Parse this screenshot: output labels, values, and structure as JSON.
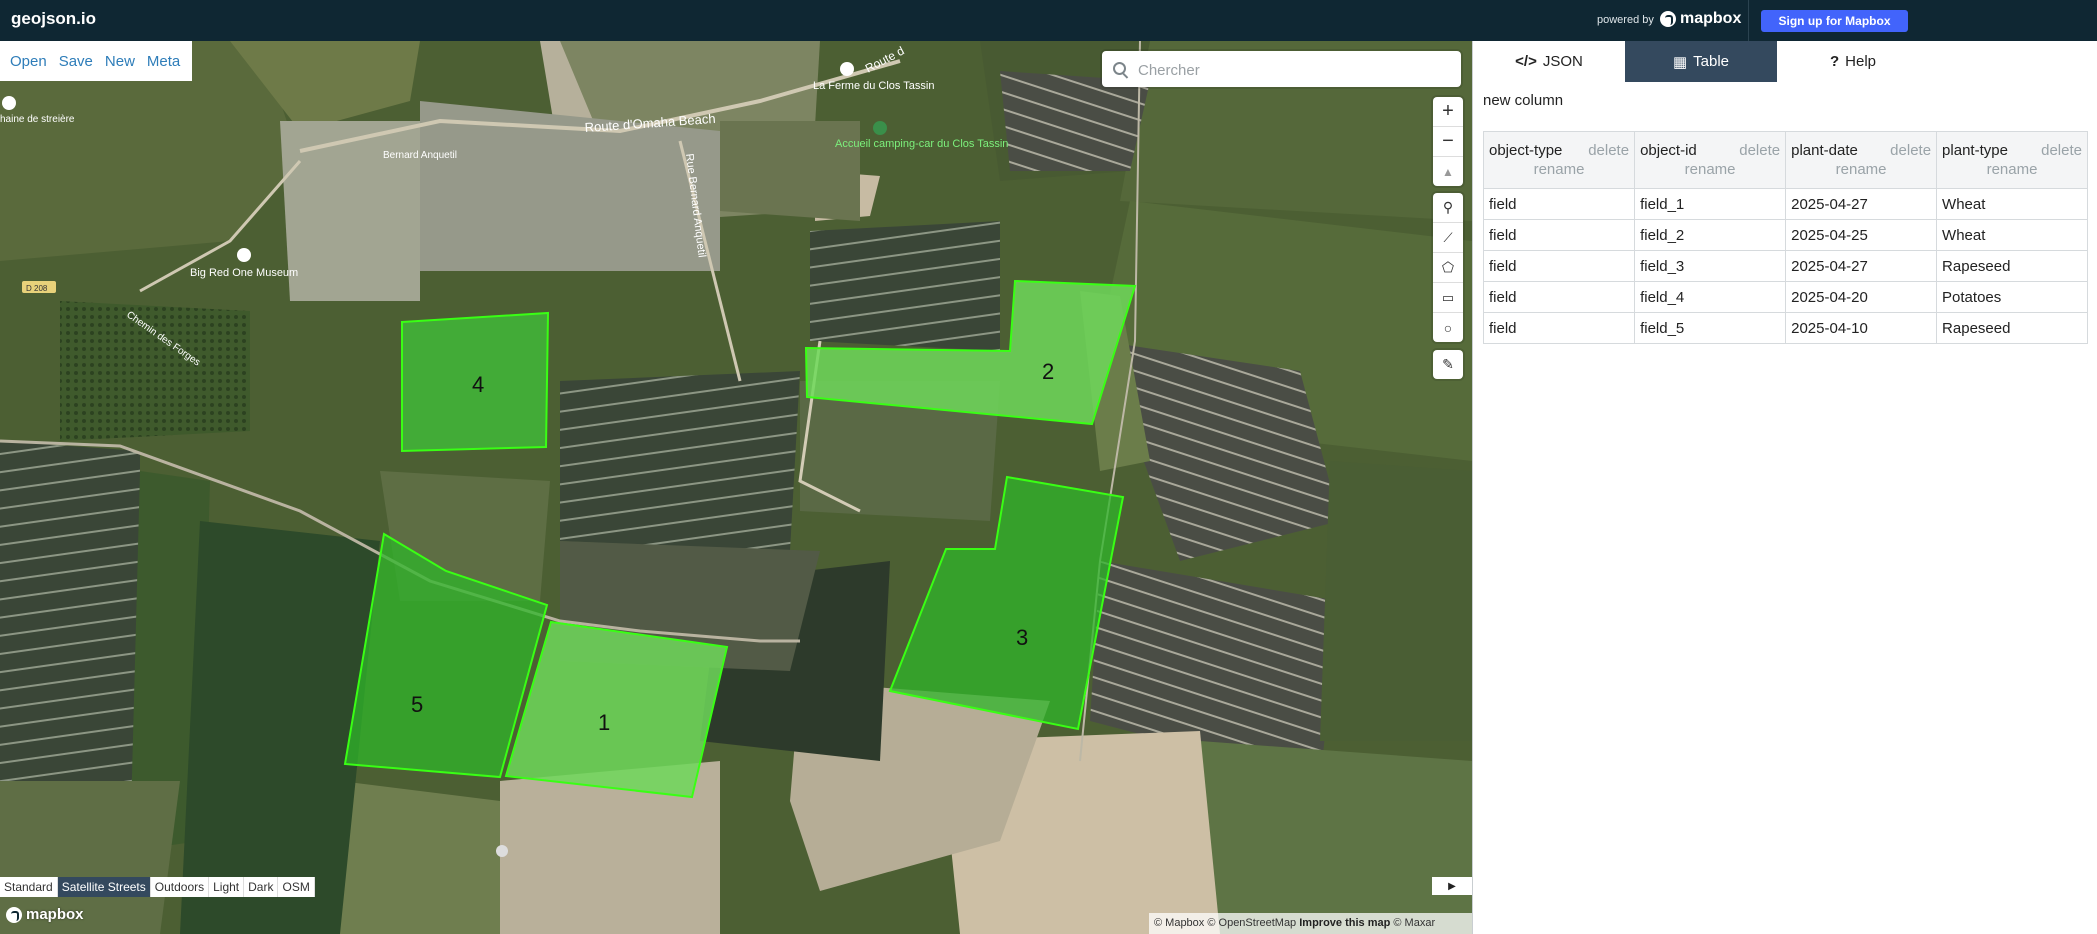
{
  "topbar": {
    "brand": "geojson.io",
    "powered_by": "powered by",
    "mapbox_logo": "mapbox",
    "signup_label": "Sign up for Mapbox"
  },
  "file_menu": [
    "Open",
    "Save",
    "New",
    "Meta"
  ],
  "search": {
    "placeholder": "Chercher"
  },
  "map_labels": {
    "route_omaha": "Route d'Omaha Beach",
    "rue_bernard": "Rue Bernard Anquetil",
    "bernard": "Bernard Anquetil",
    "ferme": "La Ferme du Clos Tassin",
    "camping": "Accueil camping-car du Clos Tassin",
    "museum": "Big Red One Museum",
    "d208": "D 208",
    "chemin_forges": "Chemin des Forges",
    "chaine": "haine de streière",
    "route_top": "Route d"
  },
  "fields": [
    {
      "id": "field_1",
      "label": "1",
      "color": "#6fd85a"
    },
    {
      "id": "field_2",
      "label": "2",
      "color": "#6fd85a"
    },
    {
      "id": "field_3",
      "label": "3",
      "color": "#2fb52a"
    },
    {
      "id": "field_4",
      "label": "4",
      "color": "#3fc43a"
    },
    {
      "id": "field_5",
      "label": "5",
      "color": "#2fb52a"
    }
  ],
  "map_styles": [
    "Standard",
    "Satellite Streets",
    "Outdoors",
    "Light",
    "Dark",
    "OSM"
  ],
  "active_style": "Satellite Streets",
  "mapbox_watermark": "mapbox",
  "attribution": {
    "mapbox": "© Mapbox",
    "osm": "© OpenStreetMap",
    "improve": "Improve this map",
    "maxar": "© Maxar"
  },
  "sidebar": {
    "tabs": [
      {
        "label": "JSON",
        "icon": "code-icon"
      },
      {
        "label": "Table",
        "icon": "table-icon"
      },
      {
        "label": "Help",
        "icon": "help-icon"
      }
    ],
    "active_tab": "Table",
    "new_column": "new column",
    "columns": [
      "object-type",
      "object-id",
      "plant-date",
      "plant-type"
    ],
    "delete_label": "delete",
    "rename_label": "rename",
    "rows": [
      [
        "field",
        "field_1",
        "2025-04-27",
        "Wheat"
      ],
      [
        "field",
        "field_2",
        "2025-04-25",
        "Wheat"
      ],
      [
        "field",
        "field_3",
        "2025-04-27",
        "Rapeseed"
      ],
      [
        "field",
        "field_4",
        "2025-04-20",
        "Potatoes"
      ],
      [
        "field",
        "field_5",
        "2025-04-10",
        "Rapeseed"
      ]
    ]
  }
}
